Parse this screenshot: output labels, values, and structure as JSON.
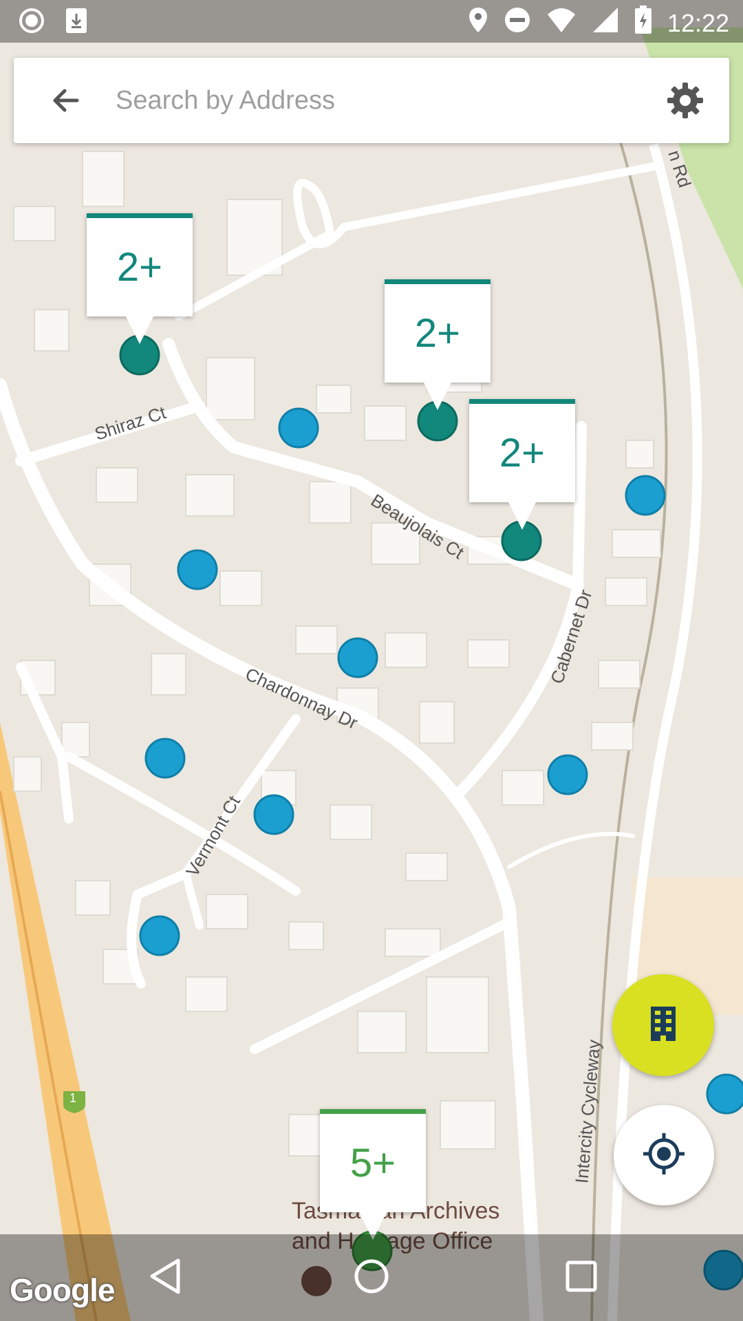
{
  "status_bar": {
    "time": "12:22",
    "icons": [
      "record-icon",
      "download-icon",
      "location-icon",
      "do-not-disturb-icon",
      "wifi-icon",
      "signal-icon",
      "battery-icon"
    ]
  },
  "search": {
    "placeholder": "Search by Address",
    "value": ""
  },
  "map": {
    "street_labels": [
      "Shiraz Ct",
      "Beaujolais Ct",
      "Cabernet Dr",
      "Chardonnay Dr",
      "Vermont Ct",
      "Intercity Cycleway",
      "n Rd"
    ],
    "poi_label_line1": "Tasmanian Archives",
    "poi_label_line2": "and Heritage Office",
    "route_shield": "1",
    "attribution": "Google",
    "colors": {
      "marker_blue": "#1a9fd0",
      "cluster_teal": "#12877c",
      "cluster_green": "#43a048",
      "fab_yellow": "#d9e021"
    }
  },
  "clusters": [
    {
      "label": "2+"
    },
    {
      "label": "2+"
    },
    {
      "label": "2+"
    },
    {
      "label": "5+"
    }
  ],
  "fab": {
    "building_icon": "building-icon",
    "locate_icon": "my-location-icon"
  },
  "nav_bar": {
    "icons": [
      "back-icon",
      "home-icon",
      "recents-icon"
    ]
  }
}
